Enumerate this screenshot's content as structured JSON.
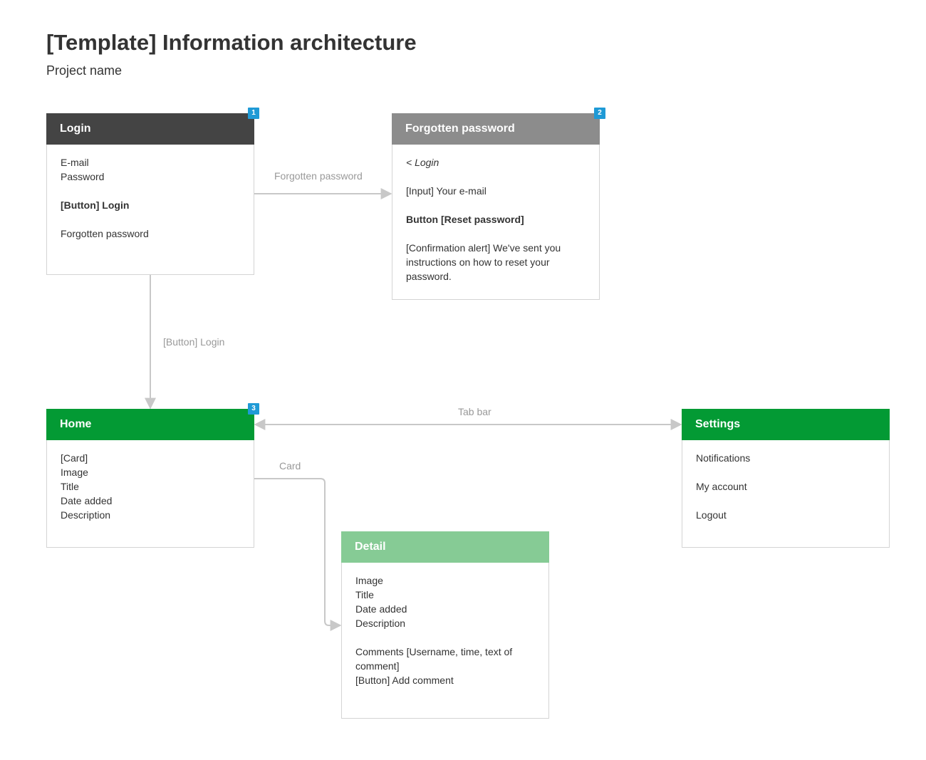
{
  "page": {
    "title": "[Template] Information architecture",
    "subtitle": "Project name"
  },
  "colors": {
    "login_header": "#444444",
    "forgot_header": "#8c8c8c",
    "home_header": "#039a34",
    "settings_header": "#039a34",
    "detail_header": "#86cb95",
    "badge": "#1f9ad6",
    "connector": "#c8c8c8",
    "edge_label": "#999999"
  },
  "nodes": {
    "login": {
      "title": "Login",
      "badge": "1",
      "lines": [
        "E-mail",
        "Password",
        "",
        "[Button] Login",
        "",
        "Forgotten password"
      ]
    },
    "forgot": {
      "title": "Forgotten password",
      "badge": "2",
      "lines": [
        "< Login",
        "",
        "[Input] Your e-mail",
        "",
        "Button [Reset password]",
        "",
        "[Confirmation alert] We've sent you",
        "instructions on how to reset your",
        "password."
      ]
    },
    "home": {
      "title": "Home",
      "badge": "3",
      "lines": [
        "[Card]",
        "Image",
        "Title",
        "Date added",
        "Description"
      ]
    },
    "settings": {
      "title": "Settings",
      "lines": [
        "Notifications",
        "",
        "My account",
        "",
        "Logout"
      ]
    },
    "detail": {
      "title": "Detail",
      "lines": [
        "Image",
        "Title",
        "Date added",
        "Description",
        "",
        "Comments [Username, time, text of",
        "comment]",
        "[Button] Add comment"
      ]
    }
  },
  "edges": {
    "login_to_forgot": "Forgotten password",
    "login_to_home": "[Button] Login",
    "home_settings": "Tab bar",
    "home_to_detail": "Card"
  }
}
